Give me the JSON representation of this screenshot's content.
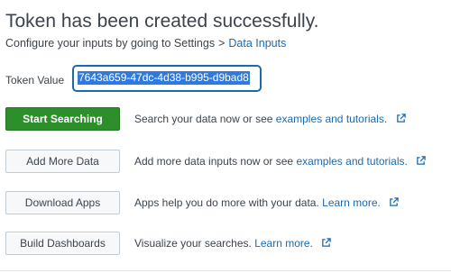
{
  "header": {
    "title": "Token has been created successfully.",
    "subtitle_prefix": "Configure your inputs by going to Settings",
    "subtitle_separator": ">",
    "subtitle_link": "Data Inputs"
  },
  "token": {
    "label": "Token Value",
    "value": "7643a659-47dc-4d38-b995-d9bad8"
  },
  "actions": [
    {
      "button": "Start Searching",
      "primary": true,
      "text": "Search your data now or see",
      "link": "examples and tutorials."
    },
    {
      "button": "Add More Data",
      "primary": false,
      "text": "Add more data inputs now or see",
      "link": "examples and tutorials."
    },
    {
      "button": "Download Apps",
      "primary": false,
      "text": "Apps help you do more with your data.",
      "link": "Learn more."
    },
    {
      "button": "Build Dashboards",
      "primary": false,
      "text": "Visualize your searches.",
      "link": "Learn more."
    }
  ],
  "colors": {
    "primary_button": "#2d8f2a",
    "link": "#1a6ab0",
    "selection": "#2f7ae0",
    "text": "#3c444d"
  },
  "icons": {
    "external_link": "external-link-icon"
  }
}
